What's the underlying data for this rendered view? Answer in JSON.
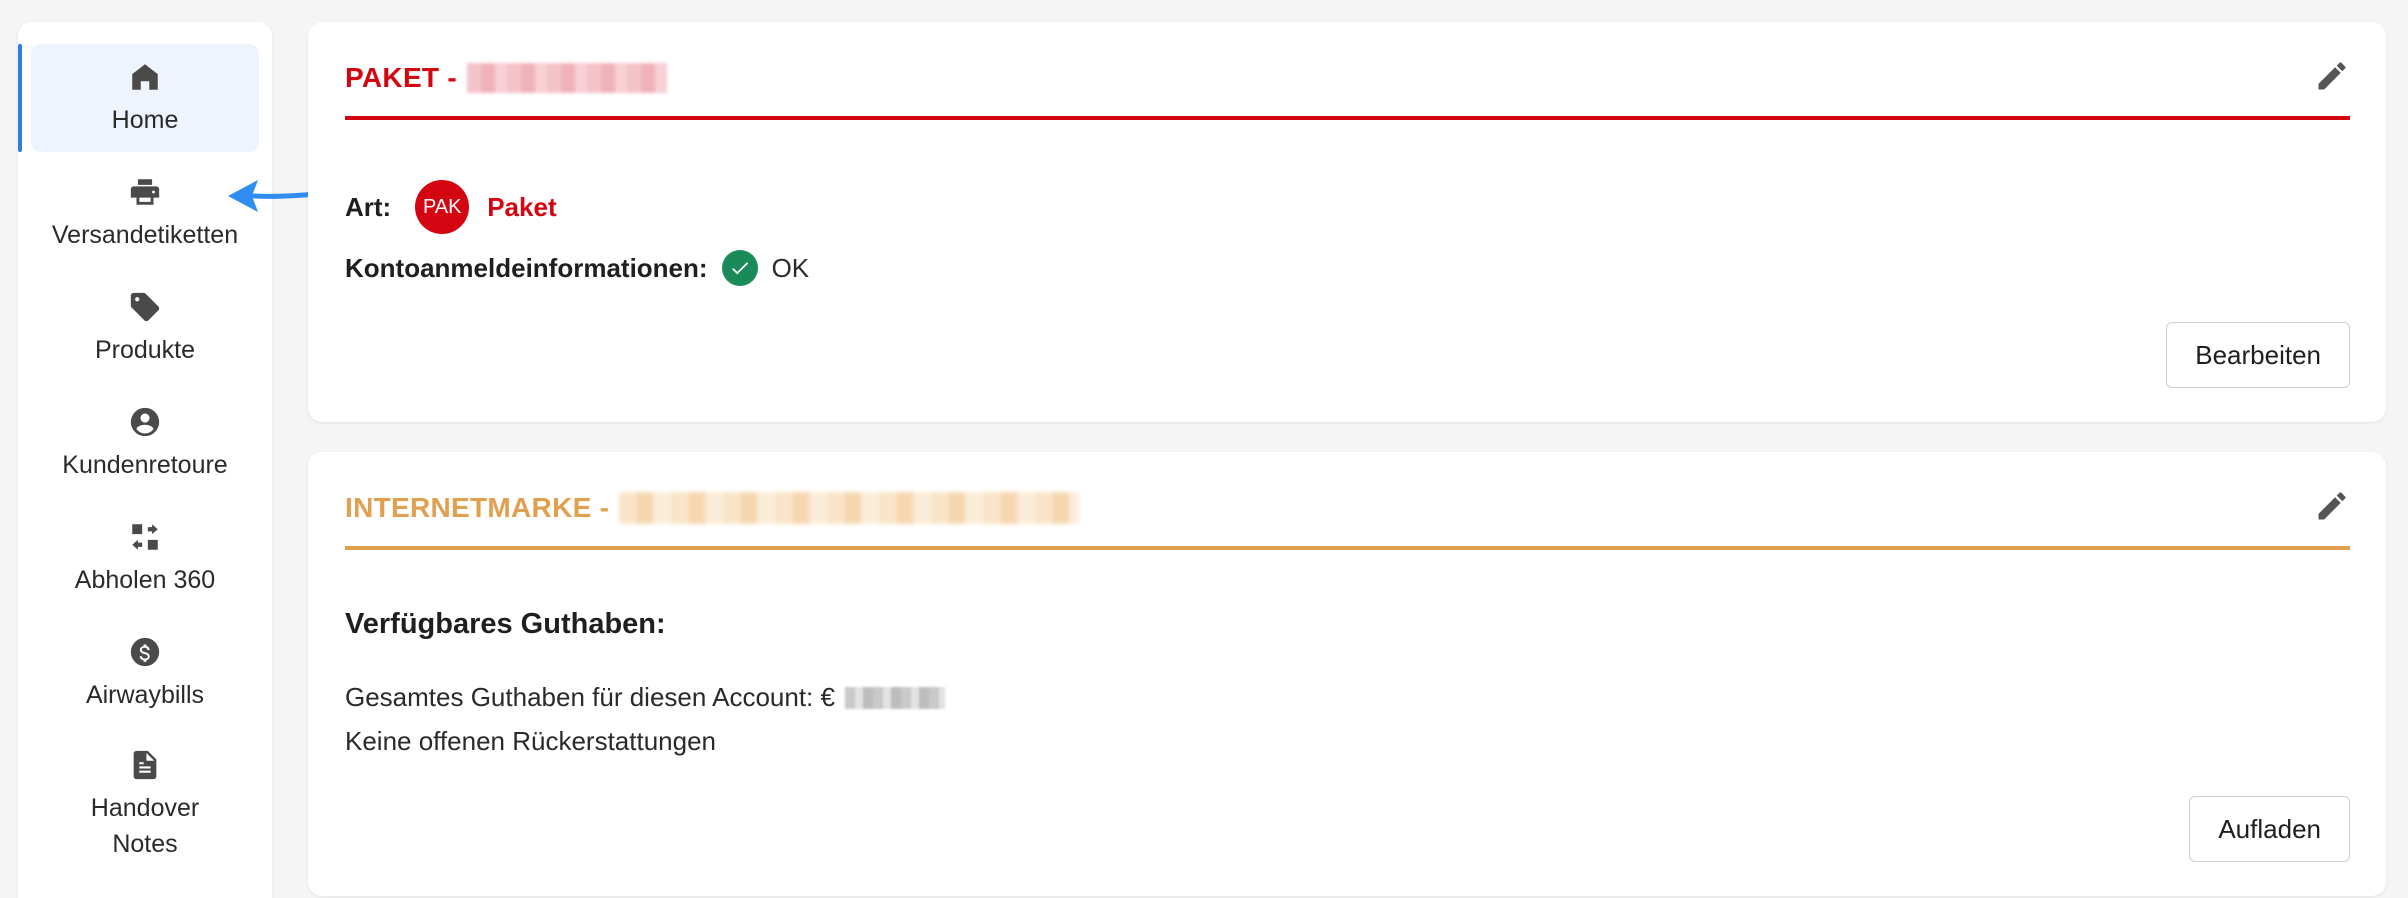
{
  "sidebar": {
    "items": [
      {
        "label": "Home",
        "icon": "home-icon",
        "active": true
      },
      {
        "label": "Versandetiketten",
        "icon": "printer-icon"
      },
      {
        "label": "Produkte",
        "icon": "tag-icon"
      },
      {
        "label": "Kundenretoure",
        "icon": "account-circle-icon"
      },
      {
        "label": "Abholen 360",
        "icon": "swap-icon"
      },
      {
        "label": "Airwaybills",
        "icon": "dollar-circle-icon"
      },
      {
        "label": "Handover Notes",
        "icon": "document-icon"
      }
    ]
  },
  "paket_card": {
    "title": "PAKET -",
    "art_label": "Art:",
    "badge": "PAK",
    "type_name": "Paket",
    "credentials_label": "Kontoanmeldeinformationen:",
    "credentials_status": "OK",
    "edit_button": "Bearbeiten"
  },
  "internetmarke_card": {
    "title": "INTERNETMARKE -",
    "balance_heading": "Verfügbares Guthaben:",
    "total_balance_label": "Gesamtes Guthaben für diesen Account: €",
    "no_refunds": "Keine offenen Rückerstattungen",
    "topup_button": "Aufladen"
  },
  "colors": {
    "accent_blue": "#2f7de1",
    "paket_red": "#d40511",
    "internetmarke_orange": "#e0a050",
    "ok_green": "#1b8a5a"
  }
}
